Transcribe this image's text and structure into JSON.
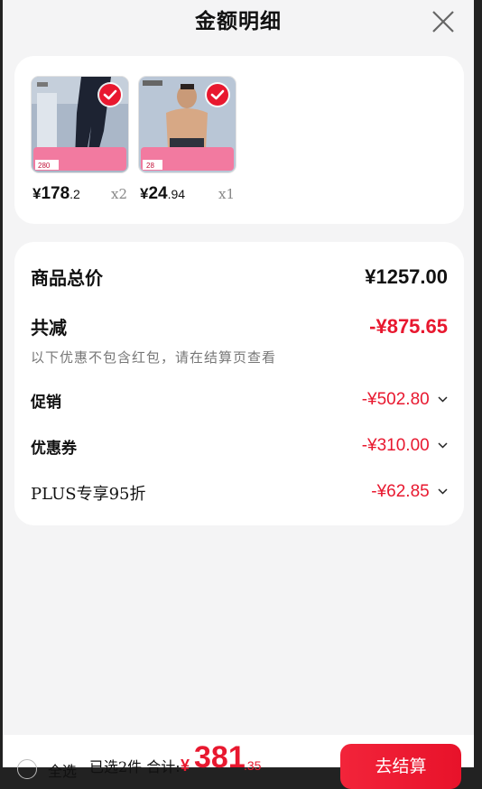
{
  "sheet": {
    "title": "金额明细"
  },
  "products": [
    {
      "currency": "¥",
      "price_int": "178",
      "price_dec": ".2",
      "qty": "x2",
      "thumb_price": "280"
    },
    {
      "currency": "¥",
      "price_int": "24",
      "price_dec": ".94",
      "qty": "x1",
      "thumb_price": "28"
    }
  ],
  "summary": {
    "total_label": "商品总价",
    "total_value": "¥1257.00",
    "discount_label": "共减",
    "discount_value": "-¥875.65",
    "note": "以下优惠不包含红包，请在结算页查看",
    "items": [
      {
        "label": "促销",
        "value": "-¥502.80"
      },
      {
        "label": "优惠券",
        "value": "-¥310.00"
      },
      {
        "label": "PLUS专享95折",
        "value": "-¥62.85"
      }
    ]
  },
  "bottom": {
    "select_all": "全选",
    "selected_info": "已选2件 合计:",
    "total_currency": "¥",
    "total_int": "381",
    "total_dec": ".35",
    "checkout_label": "去结算"
  },
  "colors": {
    "accent": "#e8182f",
    "background": "#f4f4f5"
  }
}
